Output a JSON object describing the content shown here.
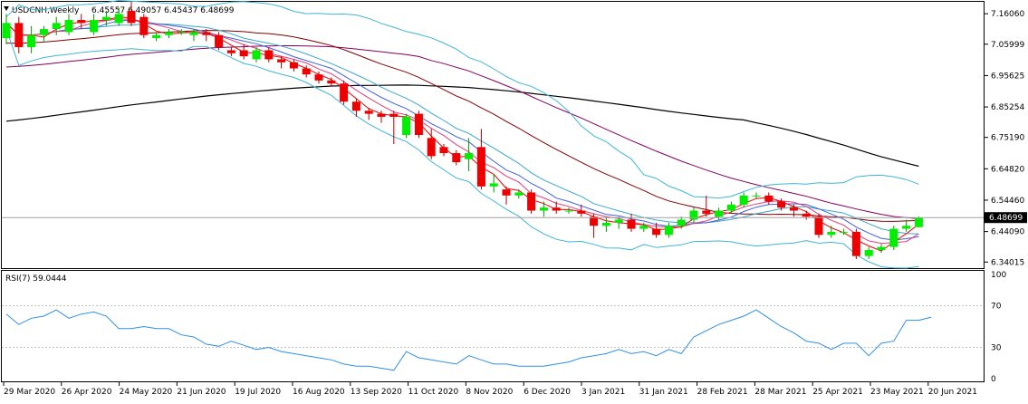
{
  "header": {
    "symbol": "USDCNH,Weekly",
    "ohlc": "6.45557 6.49057 6.45437 6.48699",
    "triangle_icon": "triangle-down-icon"
  },
  "rsi_label": "RSI(7) 59.0444",
  "current_price_label": "6.48699",
  "colors": {
    "bull": "#00ee00",
    "bear": "#ee0000",
    "bollinger": "#3fb6d6",
    "ma_fast": "#ee0000",
    "ma_pink": "#e0407a",
    "ma_blue": "#4060d8",
    "ma_teal": "#3aa8c8",
    "ma_maroon": "#800000",
    "ma_purple": "#800060",
    "ma_black": "#000000",
    "rsi": "#3090e0",
    "grid": "#c0c0c0"
  },
  "chart_data": {
    "type": "candlestick",
    "title": "USDCNH,Weekly",
    "price_axis": {
      "ticks": [
        "7.16060",
        "7.05999",
        "6.95625",
        "6.85254",
        "6.75190",
        "6.64820",
        "6.54460",
        "6.44090",
        "6.34015"
      ],
      "ylim": [
        6.32,
        7.2
      ]
    },
    "x_labels": [
      "29 Mar 2020",
      "26 Apr 2020",
      "24 May 2020",
      "21 Jun 2020",
      "19 Jul 2020",
      "16 Aug 2020",
      "13 Sep 2020",
      "11 Oct 2020",
      "8 Nov 2020",
      "6 Dec 2020",
      "3 Jan 2021",
      "31 Jan 2021",
      "28 Feb 2021",
      "28 Mar 2021",
      "25 Apr 2021",
      "23 May 2021",
      "20 Jun 2021"
    ],
    "current_price": 6.48699,
    "candles": [
      {
        "o": 7.08,
        "h": 7.16,
        "l": 7.06,
        "c": 7.13
      },
      {
        "o": 7.13,
        "h": 7.15,
        "l": 7.03,
        "c": 7.05
      },
      {
        "o": 7.05,
        "h": 7.12,
        "l": 7.03,
        "c": 7.09
      },
      {
        "o": 7.09,
        "h": 7.12,
        "l": 7.07,
        "c": 7.11
      },
      {
        "o": 7.11,
        "h": 7.15,
        "l": 7.09,
        "c": 7.13
      },
      {
        "o": 7.1,
        "h": 7.16,
        "l": 7.09,
        "c": 7.14
      },
      {
        "o": 7.14,
        "h": 7.16,
        "l": 7.11,
        "c": 7.13
      },
      {
        "o": 7.1,
        "h": 7.16,
        "l": 7.09,
        "c": 7.14
      },
      {
        "o": 7.14,
        "h": 7.17,
        "l": 7.12,
        "c": 7.15
      },
      {
        "o": 7.13,
        "h": 7.18,
        "l": 7.12,
        "c": 7.16
      },
      {
        "o": 7.17,
        "h": 7.2,
        "l": 7.12,
        "c": 7.13
      },
      {
        "o": 7.15,
        "h": 7.16,
        "l": 7.08,
        "c": 7.09
      },
      {
        "o": 7.08,
        "h": 7.1,
        "l": 7.07,
        "c": 7.09
      },
      {
        "o": 7.09,
        "h": 7.11,
        "l": 7.08,
        "c": 7.1
      },
      {
        "o": 7.1,
        "h": 7.11,
        "l": 7.09,
        "c": 7.1
      },
      {
        "o": 7.09,
        "h": 7.11,
        "l": 7.07,
        "c": 7.1
      },
      {
        "o": 7.1,
        "h": 7.11,
        "l": 7.07,
        "c": 7.09
      },
      {
        "o": 7.09,
        "h": 7.1,
        "l": 7.04,
        "c": 7.05
      },
      {
        "o": 7.04,
        "h": 7.05,
        "l": 7.02,
        "c": 7.03
      },
      {
        "o": 7.04,
        "h": 7.06,
        "l": 7.01,
        "c": 7.02
      },
      {
        "o": 7.01,
        "h": 7.05,
        "l": 7.0,
        "c": 7.04
      },
      {
        "o": 7.04,
        "h": 7.05,
        "l": 7.0,
        "c": 7.01
      },
      {
        "o": 7.01,
        "h": 7.02,
        "l": 6.98,
        "c": 7.0
      },
      {
        "o": 7.0,
        "h": 7.01,
        "l": 6.97,
        "c": 6.98
      },
      {
        "o": 6.98,
        "h": 6.99,
        "l": 6.95,
        "c": 6.96
      },
      {
        "o": 6.96,
        "h": 6.97,
        "l": 6.93,
        "c": 6.94
      },
      {
        "o": 6.94,
        "h": 6.95,
        "l": 6.92,
        "c": 6.93
      },
      {
        "o": 6.93,
        "h": 6.94,
        "l": 6.86,
        "c": 6.87
      },
      {
        "o": 6.87,
        "h": 6.88,
        "l": 6.82,
        "c": 6.84
      },
      {
        "o": 6.84,
        "h": 6.85,
        "l": 6.81,
        "c": 6.83
      },
      {
        "o": 6.83,
        "h": 6.84,
        "l": 6.8,
        "c": 6.82
      },
      {
        "o": 6.83,
        "h": 6.84,
        "l": 6.73,
        "c": 6.82
      },
      {
        "o": 6.76,
        "h": 6.83,
        "l": 6.75,
        "c": 6.82
      },
      {
        "o": 6.83,
        "h": 6.84,
        "l": 6.75,
        "c": 6.76
      },
      {
        "o": 6.75,
        "h": 6.78,
        "l": 6.68,
        "c": 6.69
      },
      {
        "o": 6.72,
        "h": 6.73,
        "l": 6.69,
        "c": 6.7
      },
      {
        "o": 6.7,
        "h": 6.71,
        "l": 6.66,
        "c": 6.67
      },
      {
        "o": 6.68,
        "h": 6.75,
        "l": 6.64,
        "c": 6.7
      },
      {
        "o": 6.72,
        "h": 6.78,
        "l": 6.58,
        "c": 6.59
      },
      {
        "o": 6.59,
        "h": 6.63,
        "l": 6.57,
        "c": 6.6
      },
      {
        "o": 6.58,
        "h": 6.59,
        "l": 6.53,
        "c": 6.56
      },
      {
        "o": 6.56,
        "h": 6.58,
        "l": 6.55,
        "c": 6.57
      },
      {
        "o": 6.57,
        "h": 6.58,
        "l": 6.5,
        "c": 6.51
      },
      {
        "o": 6.51,
        "h": 6.54,
        "l": 6.49,
        "c": 6.52
      },
      {
        "o": 6.52,
        "h": 6.54,
        "l": 6.5,
        "c": 6.51
      },
      {
        "o": 6.51,
        "h": 6.52,
        "l": 6.5,
        "c": 6.51
      },
      {
        "o": 6.51,
        "h": 6.53,
        "l": 6.49,
        "c": 6.5
      },
      {
        "o": 6.49,
        "h": 6.5,
        "l": 6.42,
        "c": 6.46
      },
      {
        "o": 6.46,
        "h": 6.49,
        "l": 6.44,
        "c": 6.47
      },
      {
        "o": 6.47,
        "h": 6.49,
        "l": 6.45,
        "c": 6.48
      },
      {
        "o": 6.48,
        "h": 6.5,
        "l": 6.44,
        "c": 6.45
      },
      {
        "o": 6.45,
        "h": 6.47,
        "l": 6.44,
        "c": 6.46
      },
      {
        "o": 6.45,
        "h": 6.47,
        "l": 6.42,
        "c": 6.43
      },
      {
        "o": 6.43,
        "h": 6.47,
        "l": 6.42,
        "c": 6.46
      },
      {
        "o": 6.46,
        "h": 6.49,
        "l": 6.45,
        "c": 6.48
      },
      {
        "o": 6.48,
        "h": 6.52,
        "l": 6.47,
        "c": 6.51
      },
      {
        "o": 6.51,
        "h": 6.56,
        "l": 6.49,
        "c": 6.5
      },
      {
        "o": 6.49,
        "h": 6.52,
        "l": 6.48,
        "c": 6.51
      },
      {
        "o": 6.51,
        "h": 6.54,
        "l": 6.5,
        "c": 6.53
      },
      {
        "o": 6.53,
        "h": 6.57,
        "l": 6.52,
        "c": 6.56
      },
      {
        "o": 6.56,
        "h": 6.57,
        "l": 6.55,
        "c": 6.56
      },
      {
        "o": 6.56,
        "h": 6.57,
        "l": 6.53,
        "c": 6.54
      },
      {
        "o": 6.54,
        "h": 6.55,
        "l": 6.51,
        "c": 6.52
      },
      {
        "o": 6.52,
        "h": 6.53,
        "l": 6.49,
        "c": 6.51
      },
      {
        "o": 6.5,
        "h": 6.51,
        "l": 6.48,
        "c": 6.49
      },
      {
        "o": 6.49,
        "h": 6.5,
        "l": 6.42,
        "c": 6.43
      },
      {
        "o": 6.43,
        "h": 6.46,
        "l": 6.42,
        "c": 6.44
      },
      {
        "o": 6.44,
        "h": 6.45,
        "l": 6.43,
        "c": 6.44
      },
      {
        "o": 6.44,
        "h": 6.45,
        "l": 6.35,
        "c": 6.36
      },
      {
        "o": 6.36,
        "h": 6.39,
        "l": 6.35,
        "c": 6.38
      },
      {
        "o": 6.38,
        "h": 6.4,
        "l": 6.37,
        "c": 6.39
      },
      {
        "o": 6.39,
        "h": 6.46,
        "l": 6.38,
        "c": 6.45
      },
      {
        "o": 6.45,
        "h": 6.48,
        "l": 6.44,
        "c": 6.46
      },
      {
        "o": 6.45557,
        "h": 6.49057,
        "l": 6.45437,
        "c": 6.48699
      }
    ],
    "rsi": {
      "name": "RSI(7)",
      "last_value": 59.0444,
      "ticks": [
        "100",
        "70",
        "30",
        "0"
      ],
      "ylim": [
        0,
        100
      ],
      "values": [
        62,
        52,
        58,
        60,
        66,
        58,
        62,
        64,
        60,
        48,
        48,
        50,
        48,
        48,
        42,
        40,
        33,
        31,
        36,
        32,
        28,
        30,
        26,
        24,
        22,
        20,
        18,
        14,
        12,
        12,
        10,
        8,
        26,
        20,
        18,
        16,
        14,
        22,
        18,
        14,
        14,
        12,
        12,
        12,
        14,
        16,
        20,
        22,
        24,
        28,
        24,
        26,
        22,
        28,
        24,
        40,
        46,
        52,
        56,
        60,
        66,
        58,
        50,
        44,
        36,
        34,
        28,
        34,
        34,
        22,
        34,
        36,
        56,
        56,
        59.0444
      ]
    }
  }
}
